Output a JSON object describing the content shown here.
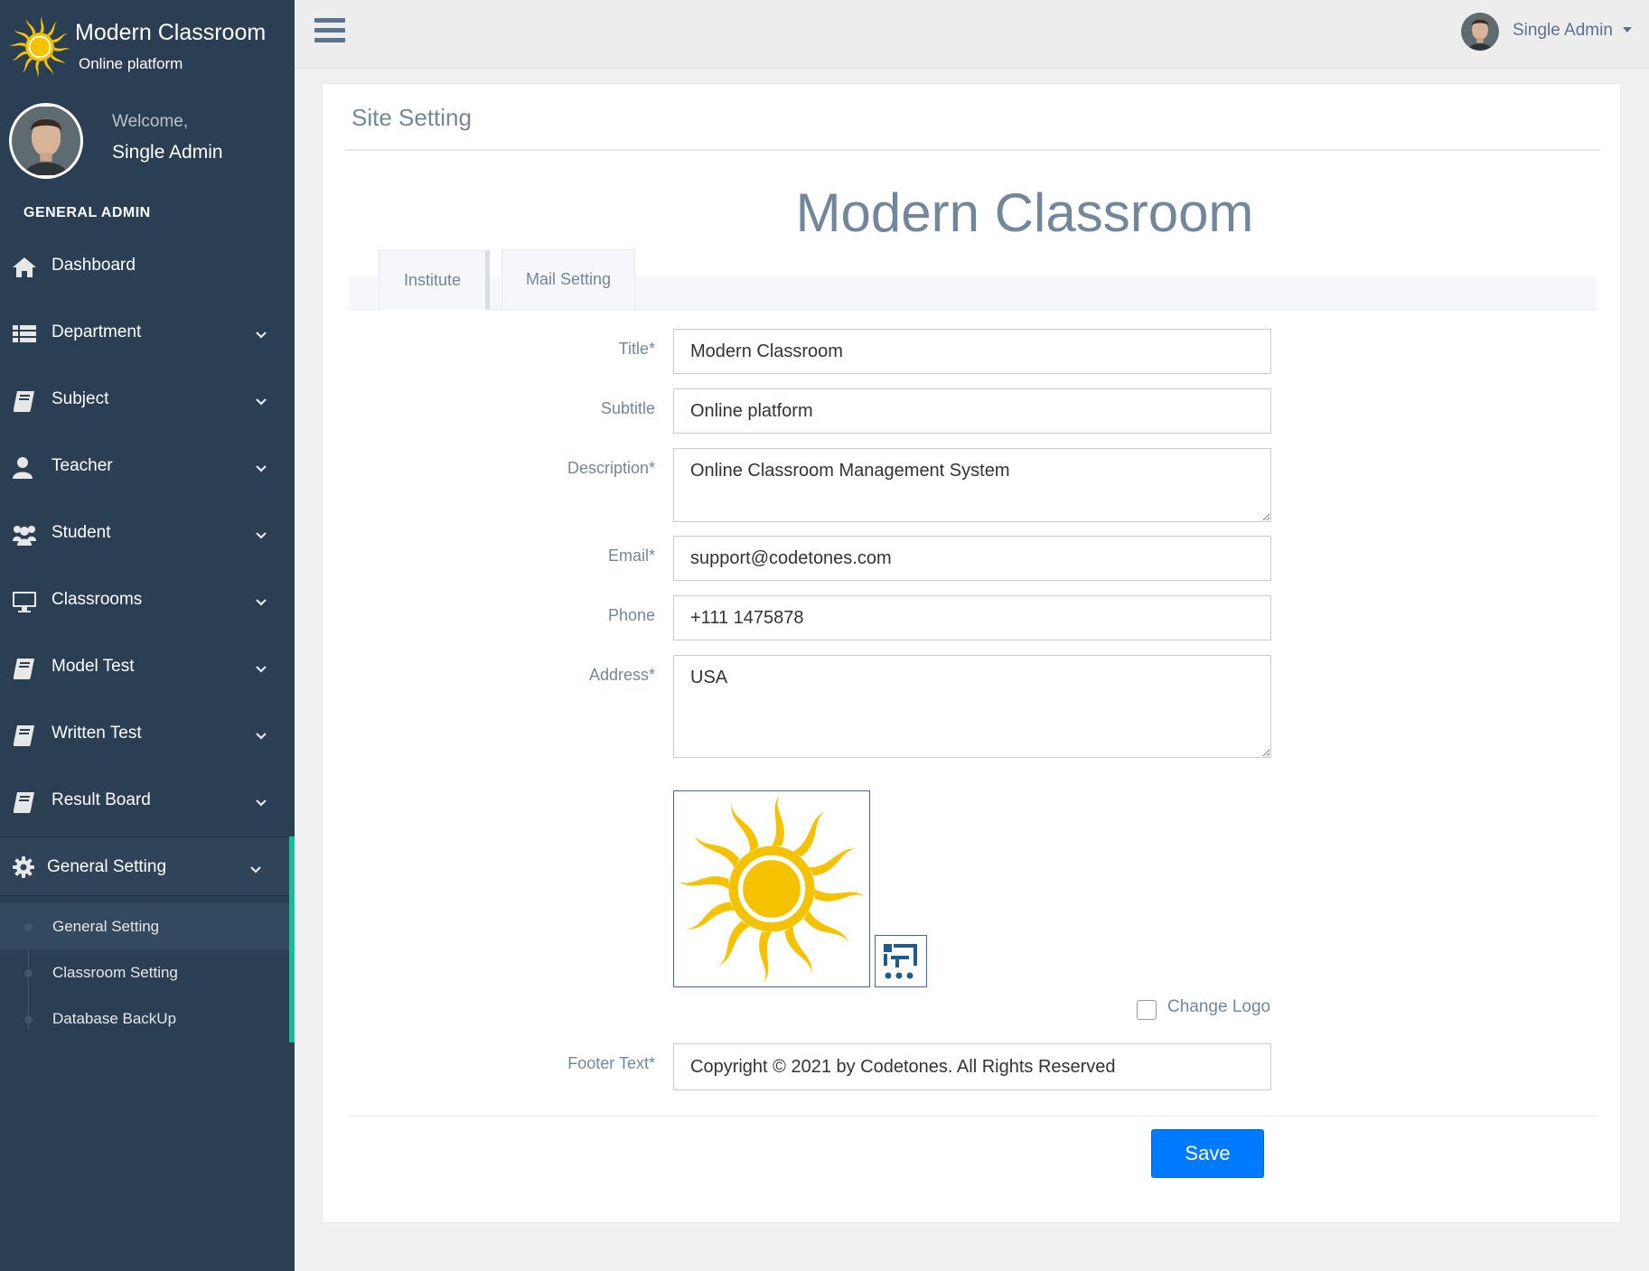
{
  "brand": {
    "title": "Modern Classroom",
    "subtitle": "Online platform"
  },
  "profile": {
    "welcome": "Welcome,",
    "name": "Single Admin"
  },
  "sidebar": {
    "section_label": "GENERAL ADMIN",
    "items": [
      {
        "label": "Dashboard",
        "icon": "home-icon"
      },
      {
        "label": "Department",
        "icon": "list-icon"
      },
      {
        "label": "Subject",
        "icon": "book-icon"
      },
      {
        "label": "Teacher",
        "icon": "user-icon"
      },
      {
        "label": "Student",
        "icon": "users-icon"
      },
      {
        "label": "Classrooms",
        "icon": "desktop-icon"
      },
      {
        "label": "Model Test",
        "icon": "book-icon"
      },
      {
        "label": "Written Test",
        "icon": "book-icon"
      },
      {
        "label": "Result Board",
        "icon": "book-icon"
      }
    ],
    "general_setting": {
      "label": "General Setting",
      "icon": "gear-icon",
      "subitems": [
        "General Setting",
        "Classroom Setting",
        "Database BackUp"
      ]
    }
  },
  "topbar": {
    "user_name": "Single Admin"
  },
  "panel": {
    "title": "Site Setting",
    "heading": "Modern Classroom",
    "tabs": [
      "Institute",
      "Mail Setting"
    ]
  },
  "form": {
    "title_label": "Title*",
    "title_value": "Modern Classroom",
    "subtitle_label": "Subtitle",
    "subtitle_value": "Online platform",
    "description_label": "Description*",
    "description_value": "Online Classroom Management System",
    "email_label": "Email*",
    "email_value": "support@codetones.com",
    "phone_label": "Phone",
    "phone_value": "+111 1475878",
    "address_label": "Address*",
    "address_value": "USA",
    "change_logo_label": "Change Logo",
    "footer_label": "Footer Text*",
    "footer_value": "Copyright © 2021 by Codetones. All Rights Reserved",
    "save_label": "Save"
  },
  "colors": {
    "sidebar_bg": "#2a3f54",
    "accent": "#1abb9c",
    "primary_button": "#007bff",
    "muted_text": "#73879c",
    "sun_yellow": "#f5c200"
  }
}
